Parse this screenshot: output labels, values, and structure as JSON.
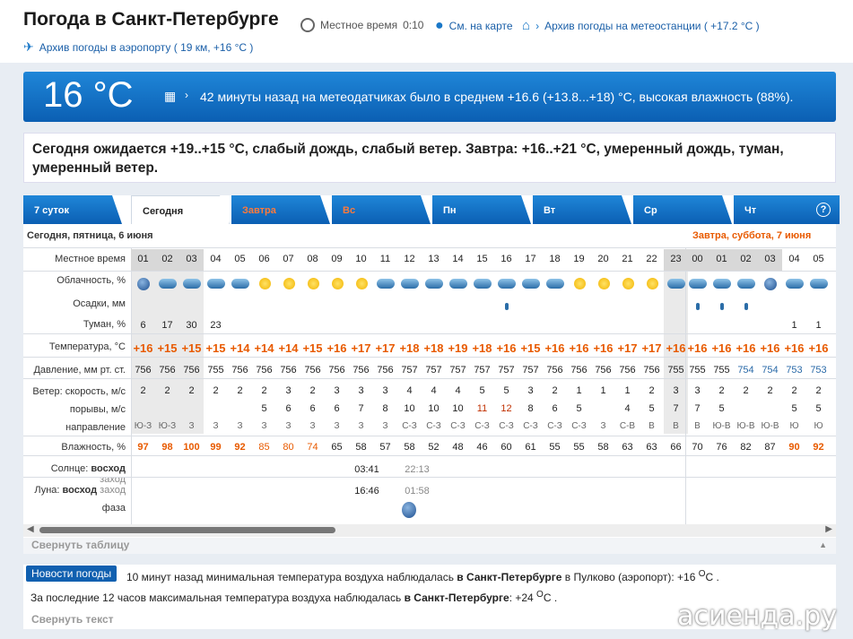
{
  "header": {
    "title": "Погода в Санкт-Петербурге",
    "local_time_label": "Местное время",
    "local_time": "0:10",
    "map_link": "См. на карте",
    "archive_station": "Архив погоды на метеостанции ( +17.2 °C )",
    "archive_airport": "Архив погоды в аэропорту ( 19 км, +16 °C )"
  },
  "current": {
    "temp": "16 °C",
    "desc": "42 минуты назад на метеодатчиках было в среднем +16.6 (+13.8...+18) °C, высокая влажность (88%)."
  },
  "forecast_text": "Сегодня ожидается +19..+15 °C, слабый дождь, слабый ветер. Завтра: +16..+21 °C, умеренный дождь, туман, умеренный ветер.",
  "tabs": [
    {
      "label": "7 суток"
    },
    {
      "label": "Сегодня"
    },
    {
      "label": "Завтра"
    },
    {
      "label": "Вс"
    },
    {
      "label": "Пн"
    },
    {
      "label": "Вт"
    },
    {
      "label": "Ср"
    },
    {
      "label": "Чт"
    }
  ],
  "help": "?",
  "day1": "Сегодня, пятница, 6 июня",
  "day2": "Завтра, суббота, 7 июня",
  "labels": {
    "time": "Местное время",
    "cloud": "Облачность, %",
    "precip": "Осадки, мм",
    "fog": "Туман, %",
    "temp": "Температура, °C",
    "pressure": "Давление, мм рт. ст.",
    "wind": "Ветер: скорость, м/с",
    "gusts": "порывы, м/с",
    "dir": "направление",
    "humidity": "Влажность, %",
    "sun_label": "Солнце:",
    "sunrise": "восход",
    "sunset": "заход",
    "moon_label": "Луна:",
    "moonrise": "восход",
    "moonset": "заход",
    "phase": "фаза"
  },
  "hours": [
    "01",
    "02",
    "03",
    "04",
    "05",
    "06",
    "07",
    "08",
    "09",
    "10",
    "11",
    "12",
    "13",
    "14",
    "15",
    "16",
    "17",
    "18",
    "19",
    "20",
    "21",
    "22",
    "23",
    "00",
    "01",
    "02",
    "03",
    "04",
    "05"
  ],
  "clouds": [
    "moon-cloud",
    "cloud",
    "cloud",
    "cloud-sun",
    "sun-cloud",
    "sun",
    "sun",
    "sun",
    "sun",
    "sun",
    "cloud-sun",
    "cloud-sun",
    "cloud",
    "cloud",
    "cloud",
    "rain-cloud",
    "cloud-sun",
    "cloud-sun",
    "sun",
    "sun",
    "sun",
    "sun",
    "cloud",
    "cloud",
    "cloud",
    "cloud",
    "moon-cloud",
    "cloud",
    "cloud"
  ],
  "fog": [
    "6",
    "17",
    "30",
    "23",
    "",
    "",
    "",
    "",
    "",
    "",
    "",
    "",
    "",
    "",
    "",
    "",
    "",
    "",
    "",
    "",
    "",
    "",
    "",
    "",
    "",
    "",
    "",
    "1",
    "1"
  ],
  "temps": [
    "+16",
    "+15",
    "+15",
    "+15",
    "+14",
    "+14",
    "+14",
    "+15",
    "+16",
    "+17",
    "+17",
    "+18",
    "+18",
    "+19",
    "+18",
    "+16",
    "+15",
    "+16",
    "+16",
    "+16",
    "+17",
    "+17",
    "+16",
    "+16",
    "+16",
    "+16",
    "+16",
    "+16",
    "+16"
  ],
  "pressure": [
    "756",
    "756",
    "756",
    "755",
    "756",
    "756",
    "756",
    "756",
    "756",
    "756",
    "756",
    "757",
    "757",
    "757",
    "757",
    "757",
    "757",
    "756",
    "756",
    "756",
    "756",
    "756",
    "755",
    "755",
    "755",
    "754",
    "754",
    "753",
    "753"
  ],
  "wind": [
    "2",
    "2",
    "2",
    "2",
    "2",
    "2",
    "3",
    "2",
    "3",
    "3",
    "3",
    "4",
    "4",
    "4",
    "5",
    "5",
    "3",
    "2",
    "1",
    "1",
    "1",
    "2",
    "3",
    "3",
    "2",
    "2",
    "2",
    "2",
    "2"
  ],
  "gusts": [
    "",
    "",
    "",
    "",
    "",
    "5",
    "6",
    "6",
    "6",
    "7",
    "8",
    "10",
    "10",
    "10",
    "11",
    "12",
    "8",
    "6",
    "5",
    "",
    "4",
    "5",
    "7",
    "7",
    "5",
    "",
    "",
    "5",
    "5"
  ],
  "dirs": [
    "Ю-З",
    "Ю-З",
    "З",
    "З",
    "З",
    "З",
    "З",
    "З",
    "З",
    "З",
    "З",
    "С-З",
    "С-З",
    "С-З",
    "С-З",
    "С-З",
    "С-З",
    "С-З",
    "С-З",
    "З",
    "С-В",
    "В",
    "В",
    "В",
    "Ю-В",
    "Ю-В",
    "Ю-В",
    "Ю",
    "Ю"
  ],
  "humidity": [
    "97",
    "98",
    "100",
    "99",
    "92",
    "85",
    "80",
    "74",
    "65",
    "58",
    "57",
    "58",
    "52",
    "48",
    "46",
    "60",
    "61",
    "55",
    "55",
    "58",
    "63",
    "63",
    "66",
    "70",
    "76",
    "82",
    "87",
    "90",
    "92"
  ],
  "sun": {
    "rise": "03:41",
    "set": "22:13"
  },
  "moon": {
    "rise": "16:46",
    "set": "01:58"
  },
  "collapse_table": "Свернуть таблицу",
  "news": {
    "tag": "Новости погоды",
    "line1a": "10 минут назад минимальная температура воздуха наблюдалась ",
    "line1b": "в Санкт-Петербурге",
    "line1c": " в Пулково (аэропорт): +16 ",
    "line1d": "O",
    "line1e": "C .",
    "line2a": "За последние 12 часов максимальная температура воздуха наблюдалась ",
    "line2b": "в Санкт-Петербурге",
    "line2c": ": +24 ",
    "line2d": "O",
    "line2e": "C .",
    "collapse": "Свернуть текст"
  },
  "watermark": "асиенда.ру"
}
